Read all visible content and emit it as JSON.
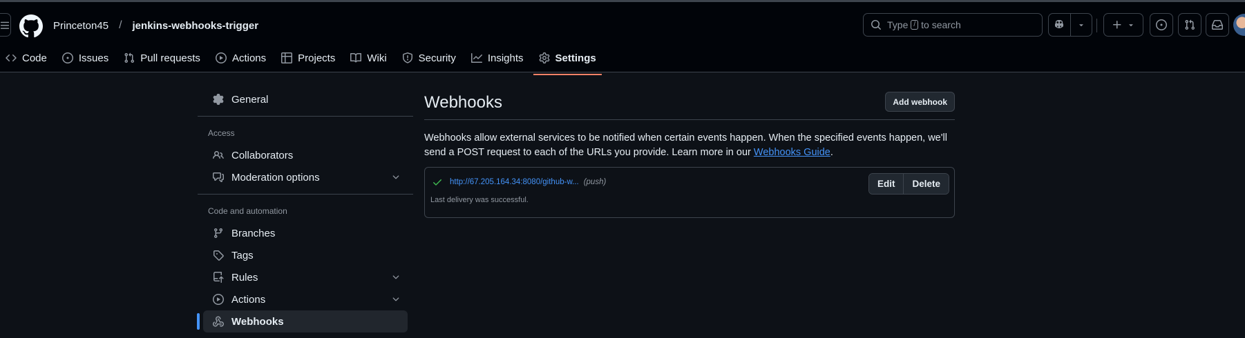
{
  "header": {
    "owner": "Princeton45",
    "separator": "/",
    "repo": "jenkins-webhooks-trigger",
    "search": {
      "prefix": "Type",
      "key": "/",
      "suffix": "to search"
    }
  },
  "tabs": [
    {
      "label": "Code",
      "icon": "code-icon"
    },
    {
      "label": "Issues",
      "icon": "issue-opened-icon"
    },
    {
      "label": "Pull requests",
      "icon": "git-pull-request-icon"
    },
    {
      "label": "Actions",
      "icon": "play-icon"
    },
    {
      "label": "Projects",
      "icon": "table-icon"
    },
    {
      "label": "Wiki",
      "icon": "book-icon"
    },
    {
      "label": "Security",
      "icon": "shield-icon"
    },
    {
      "label": "Insights",
      "icon": "graph-icon"
    },
    {
      "label": "Settings",
      "icon": "gear-icon",
      "active": true
    }
  ],
  "sidebar": {
    "general": "General",
    "access_heading": "Access",
    "collaborators": "Collaborators",
    "moderation": "Moderation options",
    "code_heading": "Code and automation",
    "branches": "Branches",
    "tags": "Tags",
    "rules": "Rules",
    "actions": "Actions",
    "webhooks": "Webhooks"
  },
  "main": {
    "title": "Webhooks",
    "add_button": "Add webhook",
    "description": "Webhooks allow external services to be notified when certain events happen. When the specified events happen, we'll send a POST request to each of the URLs you provide. Learn more in our ",
    "guide_link": "Webhooks Guide",
    "description_end": ".",
    "hook": {
      "url": "http://67.205.164.34:8080/github-w...",
      "events": "(push)",
      "status": "Last delivery was successful.",
      "edit": "Edit",
      "delete": "Delete"
    }
  },
  "colors": {
    "background": "#0d1117",
    "header": "#010409",
    "accent_link": "#4493f8",
    "active_tab_underline": "#f78166",
    "success": "#3fb950"
  }
}
